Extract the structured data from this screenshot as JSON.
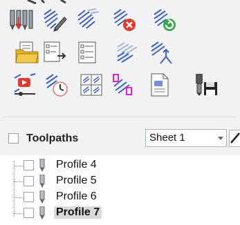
{
  "toolbar": {
    "icons": [
      {
        "name": "toolpath-operations-icon"
      },
      {
        "name": "edit-toolpath-icon"
      },
      {
        "name": "recalculate-toolpath-icon"
      },
      {
        "name": "delete-toolpath-icon"
      },
      {
        "name": "reset-toolpath-icon"
      },
      {
        "name": "open-toolpath-folder-icon"
      },
      {
        "name": "toolpath-list-export-icon"
      },
      {
        "name": "toolpath-list-icon"
      },
      {
        "name": "merge-toolpaths-icon"
      },
      {
        "name": "join-toolpaths-icon"
      },
      {
        "name": "preview-toolpath-icon"
      },
      {
        "name": "toolpath-time-icon"
      },
      {
        "name": "toolpath-template-icon"
      },
      {
        "name": "toolpath-color-icon"
      },
      {
        "name": "toolpath-summary-icon"
      },
      {
        "name": "save-toolpath-icon"
      }
    ]
  },
  "toolpaths": {
    "title": "Toolpaths",
    "sheet_select": {
      "value": "Sheet 1"
    },
    "items": [
      {
        "label": "Profile 4",
        "selected": false
      },
      {
        "label": "Profile 5",
        "selected": false
      },
      {
        "label": "Profile 6",
        "selected": false
      },
      {
        "label": "Profile 7",
        "selected": true
      }
    ]
  },
  "colors": {
    "panel_bg": "#f1f2f4",
    "icon_blue": "#3a60c8",
    "accent_red": "#e03a2e",
    "accent_green": "#3aa64a",
    "folder_yellow": "#e7b22a",
    "magenta": "#e21ce0"
  }
}
